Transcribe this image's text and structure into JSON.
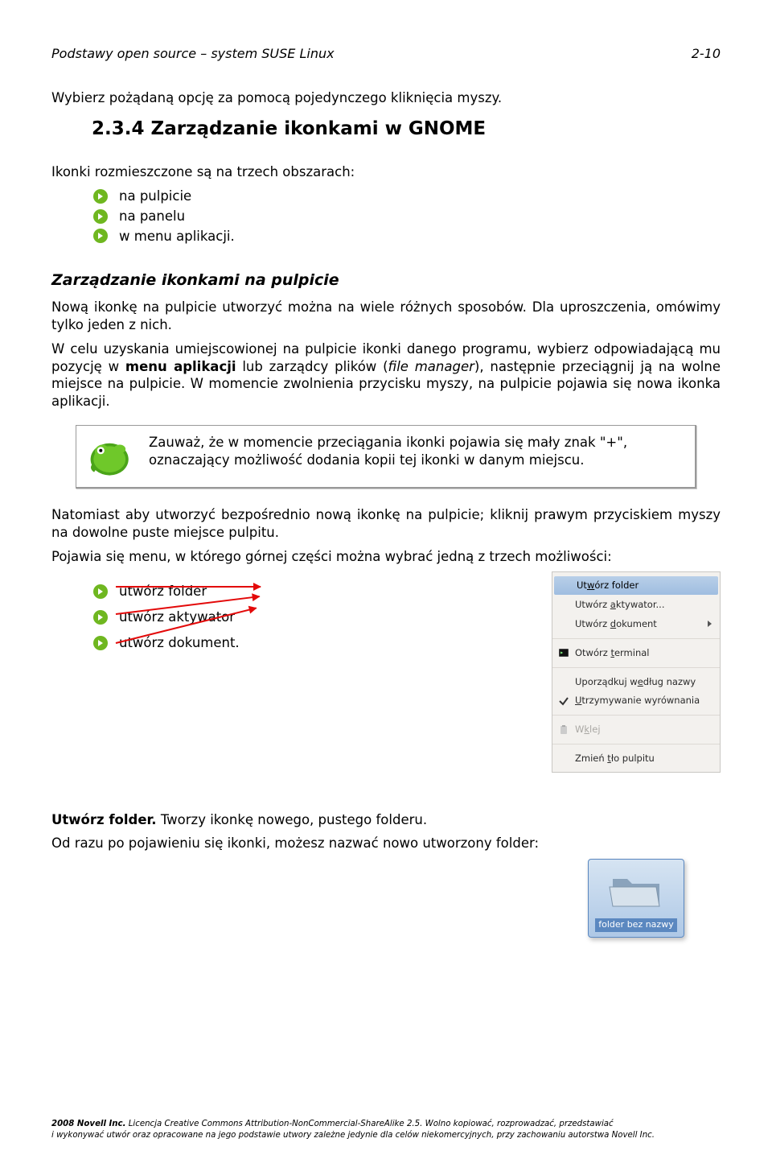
{
  "header": {
    "title": "Podstawy open source – system SUSE Linux",
    "page": "2-10"
  },
  "intro": "Wybierz pożądaną opcję za pomocą pojedynczego kliknięcia myszy.",
  "section": {
    "number": "2.3.4",
    "title": "Zarządzanie ikonkami w GNOME",
    "lead": "Ikonki rozmieszczone są na trzech obszarach:",
    "areas": [
      "na pulpicie",
      "na panelu",
      "w menu aplikacji."
    ]
  },
  "sub": {
    "title": "Zarządzanie ikonkami na pulpicie",
    "p1": "Nową ikonkę na pulpicie utworzyć można na wiele różnych sposobów. Dla uproszczenia, omówimy tylko jeden z nich.",
    "p2_a": "W celu uzyskania umiejscowionej na pulpicie ikonki danego programu, wybierz odpowiadającą mu pozycję w ",
    "p2_b": "menu aplikacji",
    "p2_c": " lub zarządcy plików (",
    "p2_d": "file manager",
    "p2_e": "), następnie przeciągnij ją na wolne miejsce na pulpicie. W momencie zwolnienia przycisku myszy, na pulpicie pojawia się nowa ikonka aplikacji.",
    "callout": "Zauważ, że w momencie przeciągania ikonki pojawia się mały znak \"+\", oznaczający możliwość dodania kopii tej ikonki w danym miejscu.",
    "p3": "Natomiast aby utworzyć bezpośrednio nową ikonkę na pulpicie; kliknij prawym przyciskiem myszy na dowolne puste  miejsce  pulpitu.",
    "p4": "Pojawia się menu, w którego górnej części można wybrać jedną z trzech możliwości:",
    "options": [
      "utwórz folder",
      "utwórz aktywator",
      "utwórz dokument."
    ],
    "utworz": {
      "label": "Utwórz folder.",
      "desc": " Tworzy ikonkę nowego, pustego folderu.",
      "after": "Od razu po pojawieniu się ikonki, możesz nazwać nowo utworzony folder:"
    },
    "folder_caption": "folder bez nazwy"
  },
  "context_menu": {
    "items": [
      {
        "label_pre": "Ut",
        "u": "w",
        "label_post": "órz folder",
        "sel": true
      },
      {
        "label_pre": "Utwórz ",
        "u": "a",
        "label_post": "ktywator..."
      },
      {
        "label_pre": "Utwórz ",
        "u": "d",
        "label_post": "okument",
        "submenu": true
      }
    ],
    "items2": [
      {
        "icon": "terminal",
        "label_pre": "Otwórz ",
        "u": "t",
        "label_post": "erminal"
      }
    ],
    "items3": [
      {
        "label_pre": "Uporządkuj w",
        "u": "e",
        "label_post": "dług nazwy"
      },
      {
        "check": true,
        "label_pre": "",
        "u": "U",
        "label_post": "trzymywanie wyrównania"
      }
    ],
    "items4": [
      {
        "icon": "paste",
        "label_pre": "W",
        "u": "k",
        "label_post": "lej",
        "disabled": true
      }
    ],
    "items5": [
      {
        "label_pre": "Zmień ",
        "u": "t",
        "label_post": "ło pulpitu"
      }
    ]
  },
  "copyright": {
    "l1a": "2008 Novell Inc.",
    "l1b": " Licencja Creative Commons Attribution-NonCommercial-ShareAlike 2.5. Wolno kopiować, rozprowadzać, przedstawiać",
    "l2": "i wykonywać utwór oraz opracowane na jego podstawie utwory zależne jedynie dla celów niekomercyjnych, przy zachowaniu autorstwa Novell Inc."
  }
}
